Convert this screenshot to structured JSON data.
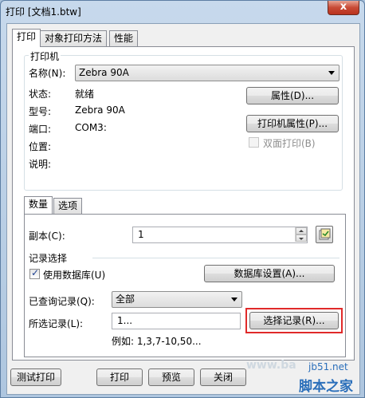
{
  "window": {
    "title": "打印 [文档1.btw]",
    "close_glyph": "x"
  },
  "tabs": [
    {
      "label": "打印",
      "active": true
    },
    {
      "label": "对象打印方法",
      "active": false
    },
    {
      "label": "性能",
      "active": false
    }
  ],
  "printer": {
    "group_label": "打印机",
    "name_label": "名称(N):",
    "name_value": "Zebra 90A",
    "status_label": "状态:",
    "status_value": "就绪",
    "model_label": "型号:",
    "model_value": "Zebra 90A",
    "port_label": "端口:",
    "port_value": "COM3:",
    "location_label": "位置:",
    "comment_label": "说明:",
    "properties_button": "属性(D)...",
    "printer_properties_button": "打印机属性(P)...",
    "duplex_label": "双面打印(B)",
    "duplex_checked": false
  },
  "subtabs": [
    {
      "label": "数量",
      "active": true
    },
    {
      "label": "选项",
      "active": false
    }
  ],
  "quantity": {
    "copies_label": "副本(C):",
    "copies_value": "1"
  },
  "records": {
    "group_label": "记录选择",
    "use_database_label": "使用数据库(U)",
    "use_database_checked": true,
    "database_settings_button": "数据库设置(A)...",
    "queried_label": "已查询记录(Q):",
    "queried_value": "全部",
    "selected_label": "所选记录(L):",
    "selected_value": "1...",
    "select_records_button": "选择记录(R)...",
    "example_text": "例如:   1,3,7-10,50..."
  },
  "footer": {
    "test_print_button": "测试打印",
    "print_button": "打印",
    "preview_button": "预览",
    "close_button": "关闭"
  },
  "watermark": {
    "site_text": "www.ba",
    "brand_url": "jb51.net",
    "brand_name": "脚本之家"
  },
  "colors": {
    "highlight": "#e02a2a",
    "brand": "#2b6fba"
  }
}
